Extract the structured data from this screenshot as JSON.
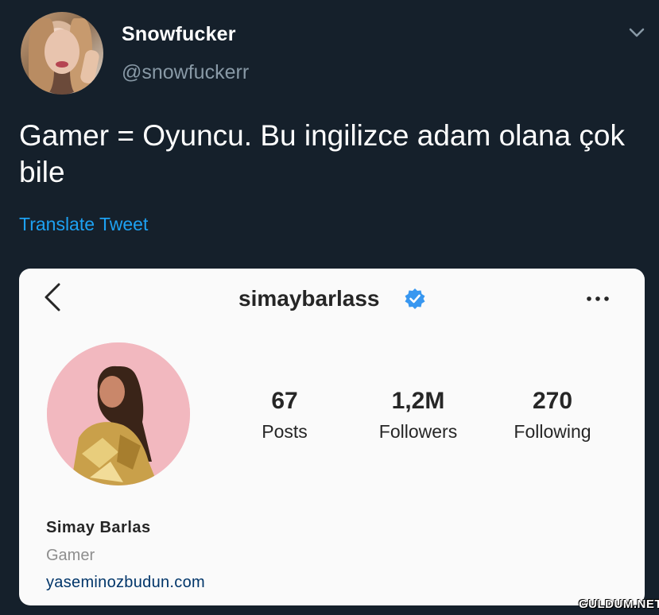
{
  "tweet": {
    "display_name": "Snowfucker",
    "handle": "@snowfuckerr",
    "text": "Gamer = Oyuncu. Bu ingilizce adam olana çok bile",
    "translate_label": "Translate Tweet",
    "menu_icon": "chevron-down-icon",
    "avatar_icon": "avatar"
  },
  "instagram_card": {
    "back_icon": "back-chevron-icon",
    "username": "simaybarlass",
    "verified_icon": "verified-badge-icon",
    "verified_color": "#3897f0",
    "more_icon": "more-dots-icon",
    "stats": [
      {
        "value": "67",
        "label": "Posts"
      },
      {
        "value": "1,2M",
        "label": "Followers"
      },
      {
        "value": "270",
        "label": "Following"
      }
    ],
    "bio": {
      "name": "Simay Barlas",
      "category": "Gamer",
      "link": "yaseminozbudun.com"
    }
  },
  "watermark": "GULDUM.NET",
  "colors": {
    "background": "#15202b",
    "handle": "#8899a6",
    "link": "#1da1f2",
    "card_bg": "#fafafa"
  }
}
